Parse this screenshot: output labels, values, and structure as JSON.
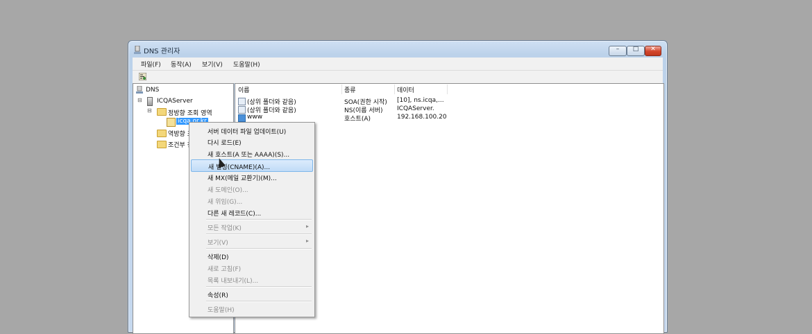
{
  "window": {
    "title": "DNS 관리자",
    "buttons": {
      "minimize": "–",
      "maximize": "□",
      "close": "✕"
    }
  },
  "menubar": {
    "items": [
      "파일(F)",
      "동작(A)",
      "보기(V)",
      "도움말(H)"
    ]
  },
  "tree": {
    "root": "DNS",
    "server": "ICQAServer",
    "forward_zone": "정방향 조회 영역",
    "zone": "icqa.or.kr",
    "reverse_zone": "역방향 조",
    "conditional": "조건부 전",
    "expand_minus": "⊟"
  },
  "list": {
    "columns": [
      "이름",
      "종류",
      "데이터"
    ],
    "rows": [
      {
        "name": "(상위 폴더와 같음)",
        "type": "SOA(권한 시작)",
        "data": "[10], ns.icqa,..."
      },
      {
        "name": "(상위 폴더와 같음)",
        "type": "NS(이름 서버)",
        "data": "ICQAServer."
      },
      {
        "name": "www",
        "type": "호스트(A)",
        "data": "192.168.100.20"
      }
    ]
  },
  "context_menu": {
    "items": [
      {
        "label": "서버 데이터 파일 업데이트(U)",
        "disabled": false
      },
      {
        "label": "다시 로드(E)",
        "disabled": false
      },
      {
        "label": "새 호스트(A 또는 AAAA)(S)...",
        "disabled": false
      },
      {
        "label": "새 별칭(CNAME)(A)...",
        "disabled": false,
        "highlighted": true
      },
      {
        "label": "새 MX(메일 교환기)(M)...",
        "disabled": false
      },
      {
        "label": "새 도메인(O)...",
        "disabled": true
      },
      {
        "label": "새 위임(G)...",
        "disabled": true
      },
      {
        "label": "다른 새 레코드(C)...",
        "disabled": false
      },
      {
        "label": "모든 작업(K)",
        "disabled": true,
        "submenu": true
      },
      {
        "label": "보기(V)",
        "disabled": true,
        "submenu": true
      },
      {
        "label": "삭제(D)",
        "disabled": false
      },
      {
        "label": "새로 고침(F)",
        "disabled": true
      },
      {
        "label": "목록 내보내기(L)...",
        "disabled": true
      },
      {
        "label": "속성(R)",
        "disabled": false
      },
      {
        "label": "도움말(H)",
        "disabled": true
      }
    ],
    "submenu_arrow": "▸"
  },
  "colors": {
    "desktop": "#a7a7a7",
    "selection": "#3399ff",
    "highlight_border": "#7db6ea"
  }
}
